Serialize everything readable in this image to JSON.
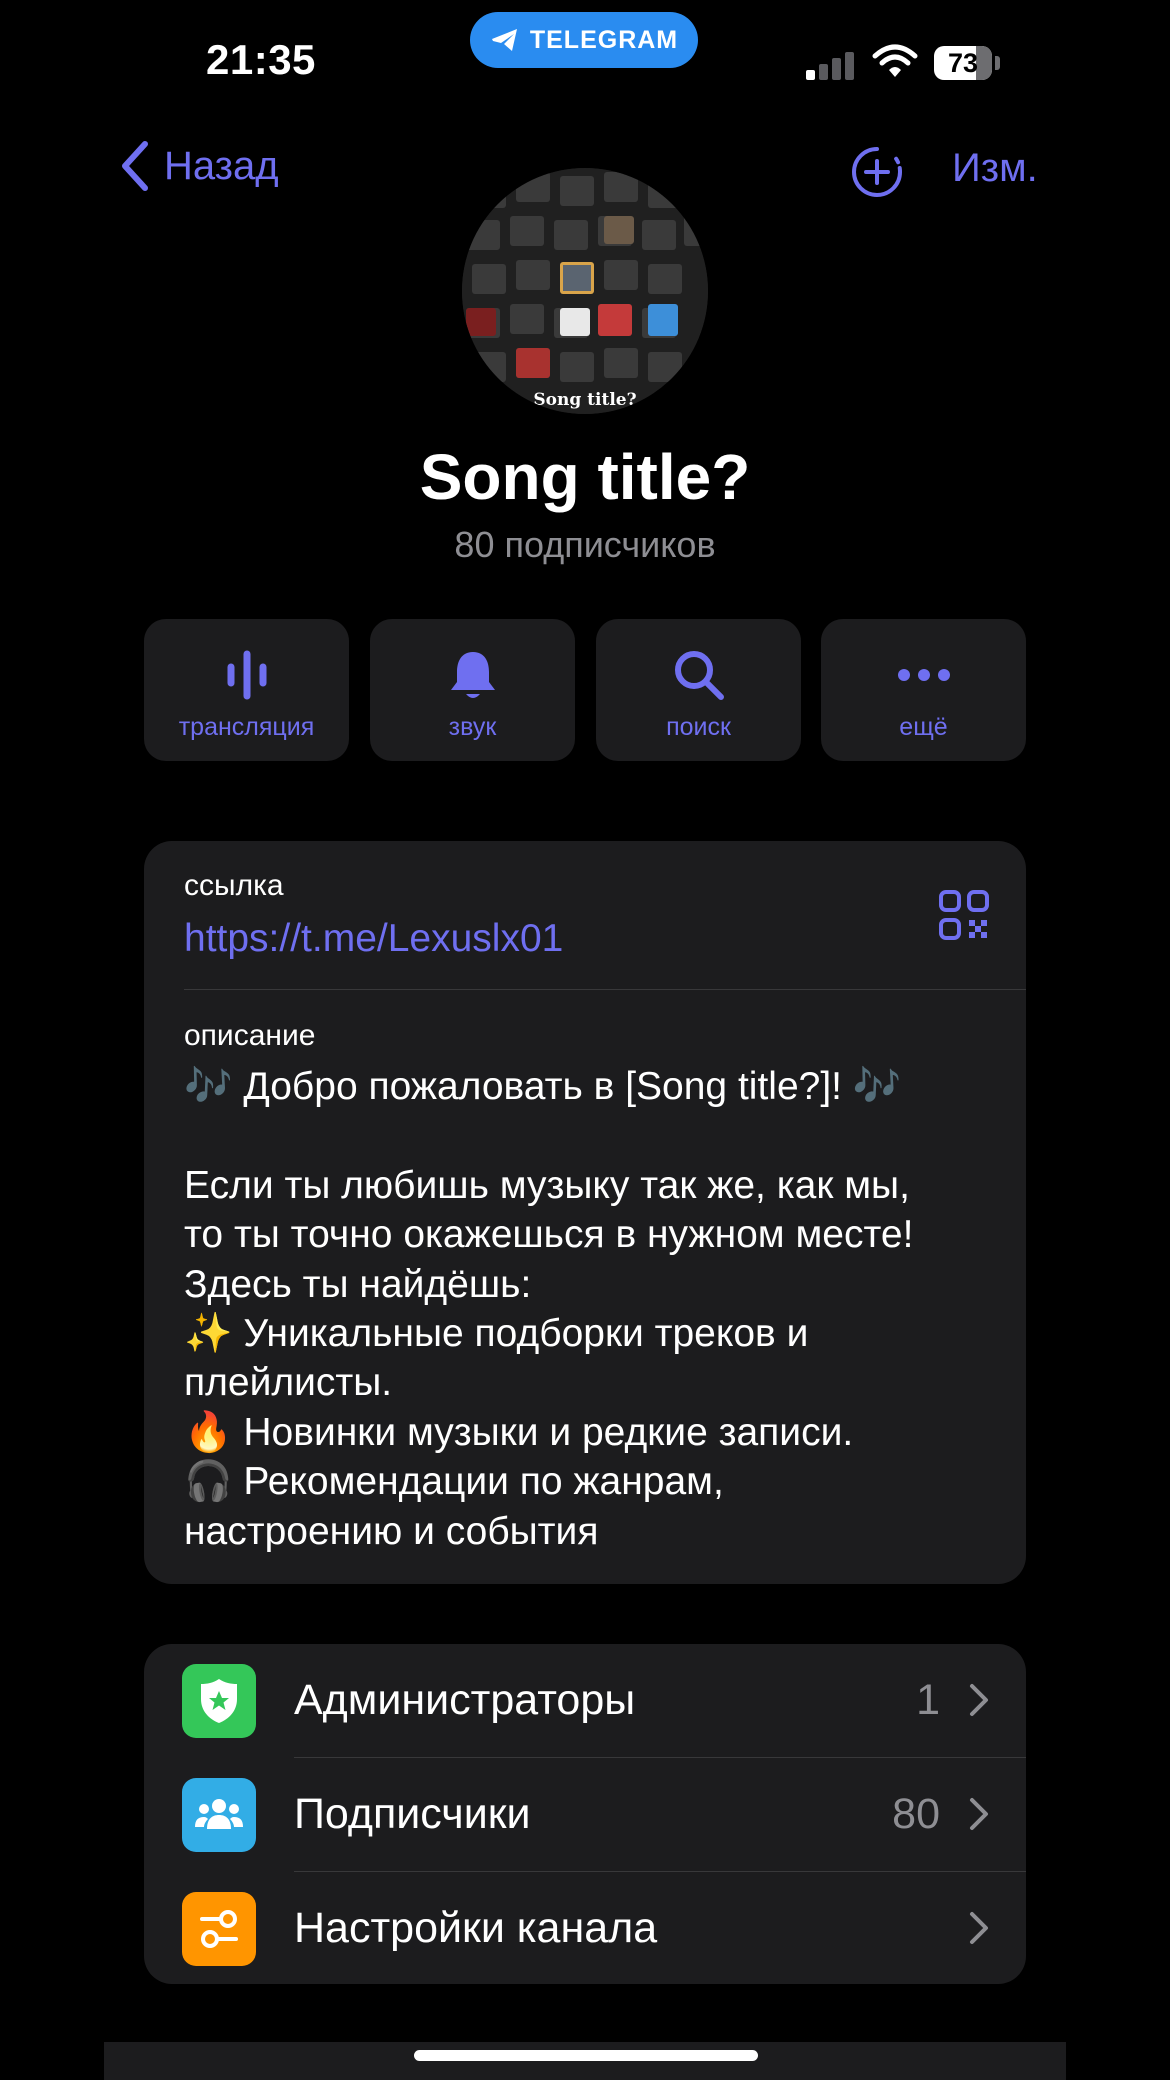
{
  "status_bar": {
    "time": "21:35",
    "app_pill": "TELEGRAM",
    "battery": "73"
  },
  "nav": {
    "back_label": "Назад",
    "edit_label": "Изм."
  },
  "channel": {
    "avatar_caption": "Song title?",
    "title": "Song title?",
    "subtitle": "80 подписчиков"
  },
  "actions": [
    {
      "label": "трансляция",
      "icon": "live-stream-icon"
    },
    {
      "label": "звук",
      "icon": "bell-icon"
    },
    {
      "label": "поиск",
      "icon": "search-icon"
    },
    {
      "label": "ещё",
      "icon": "more-icon"
    }
  ],
  "info": {
    "link_label": "ссылка",
    "link": "https://t.me/Lexuslx01",
    "description_label": "описание",
    "description": "🎶 Добро пожаловать в [Song title?]! 🎶\n\nЕсли ты любишь музыку так же, как мы,\nто ты точно окажешься в нужном месте!\nЗдесь ты найдёшь:\n✨ Уникальные подборки треков и\nплейлисты.\n🔥 Новинки музыки и редкие записи.\n🎧 Рекомендации по жанрам,\nнастроению и события"
  },
  "settings_rows": [
    {
      "label": "Администраторы",
      "value": "1",
      "icon": "shield-star-icon",
      "color": "#34c759"
    },
    {
      "label": "Подписчики",
      "value": "80",
      "icon": "people-icon",
      "color": "#32ade6"
    },
    {
      "label": "Настройки канала",
      "value": "",
      "icon": "sliders-icon",
      "color": "#ff9500"
    }
  ],
  "colors": {
    "accent": "#6f6ff0",
    "background": "#000000",
    "card": "#1c1c1e",
    "secondary_text": "#8e8e93",
    "telegram_pill": "#2a8cf0"
  }
}
